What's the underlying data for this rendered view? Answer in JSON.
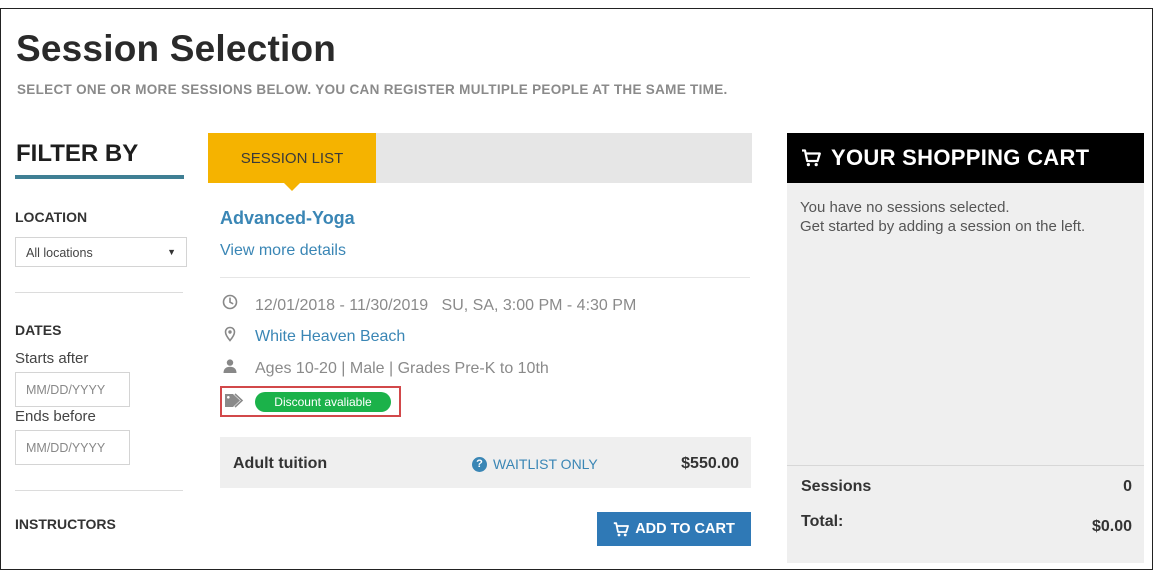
{
  "header": {
    "title": "Session Selection",
    "subtitle": "SELECT ONE OR MORE SESSIONS BELOW. YOU CAN REGISTER MULTIPLE PEOPLE AT THE SAME TIME."
  },
  "filter": {
    "title": "FILTER BY",
    "location_label": "LOCATION",
    "location_value": "All locations",
    "dates_label": "DATES",
    "starts_after_label": "Starts after",
    "starts_after_placeholder": "MM/DD/YYYY",
    "ends_before_label": "Ends before",
    "ends_before_placeholder": "MM/DD/YYYY",
    "instructors_label": "INSTRUCTORS"
  },
  "session_list": {
    "tab_label": "SESSION LIST",
    "session": {
      "name": "Advanced-Yoga",
      "details_link": "View more details",
      "schedule": "12/01/2018 - 11/30/2019   SU, SA, 3:00 PM - 4:30 PM",
      "location": "White Heaven Beach",
      "eligibility": "Ages 10-20 | Male | Grades Pre-K to 10th",
      "discount_badge": "Discount avaliable",
      "price_name": "Adult tuition",
      "waitlist": "WAITLIST ONLY",
      "price": "$550.00",
      "add_button": "ADD TO CART"
    }
  },
  "cart": {
    "title": "YOUR SHOPPING CART",
    "empty_line1": "You have no sessions selected.",
    "empty_line2": "Get started by adding a session on the left.",
    "sessions_label": "Sessions",
    "sessions_count": "0",
    "total_label": "Total:",
    "total_value": "$0.00"
  },
  "colors": {
    "accent_tab": "#f5b300",
    "link": "#3a86b5",
    "filter_underline": "#3f7f94",
    "discount_green": "#1bb24a",
    "highlight_box": "#d2484a",
    "button_blue": "#2f79b6"
  },
  "icons": [
    "clock-icon",
    "map-pin-icon",
    "person-icon",
    "tag-icon",
    "cart-icon",
    "question-icon",
    "caret-down-icon"
  ]
}
